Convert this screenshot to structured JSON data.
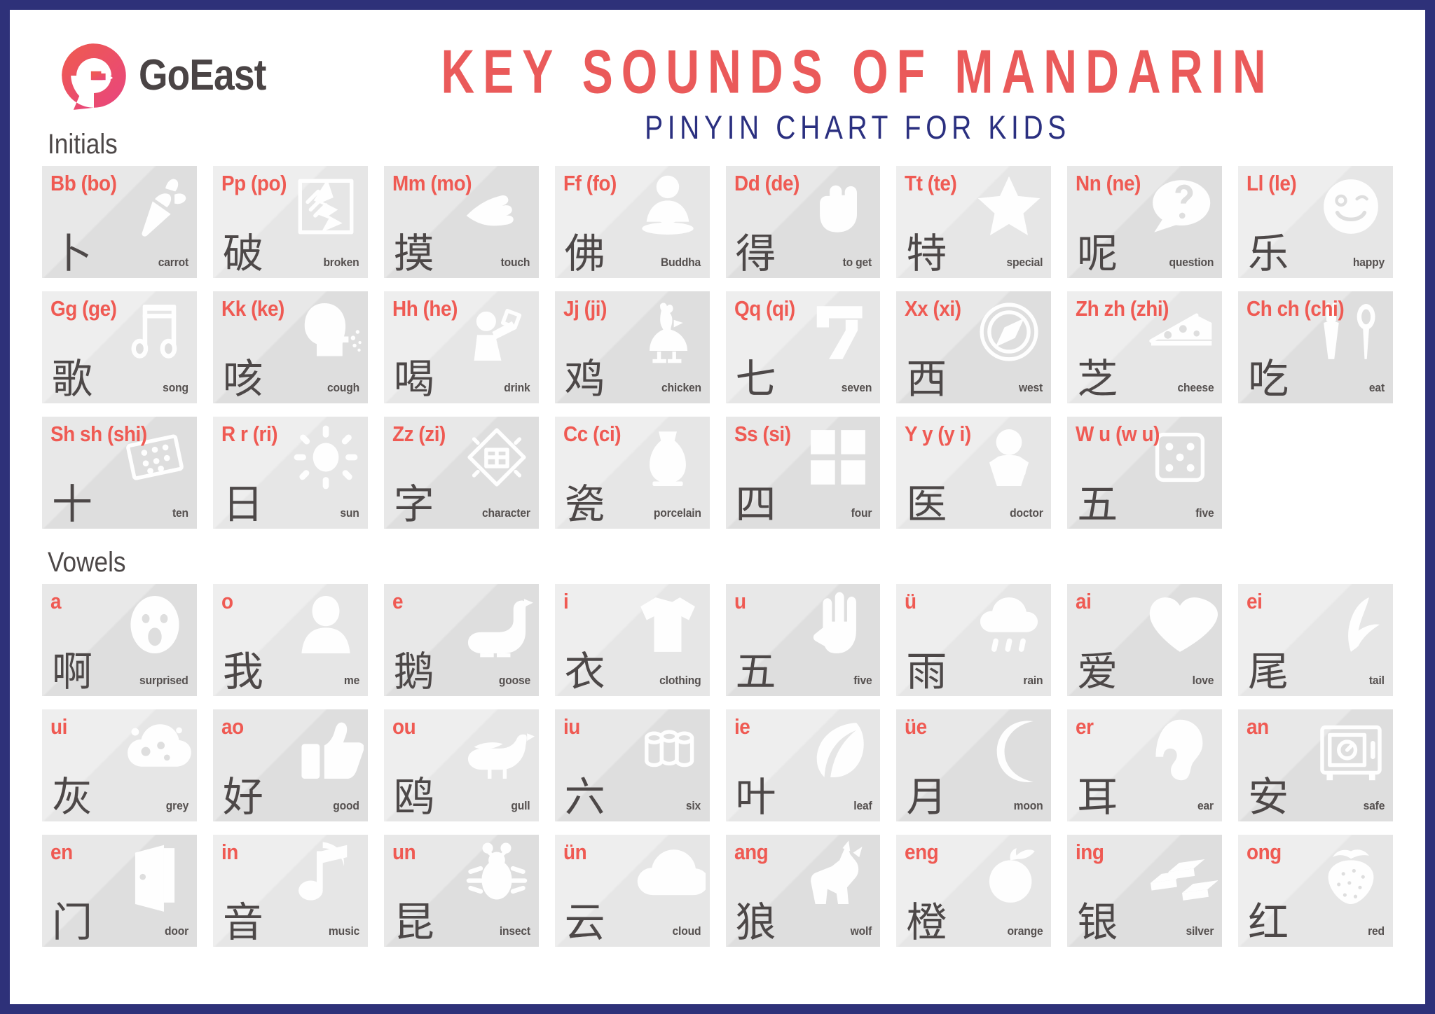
{
  "brand": {
    "name": "GoEast",
    "logo_icon": "goeast-g-logo-icon"
  },
  "header": {
    "title": "KEY SOUNDS OF MANDARIN",
    "subtitle": "PINYIN CHART FOR KIDS",
    "title_color": "#ea5a5a",
    "subtitle_color": "#2b3080",
    "frame_color": "#2e3179"
  },
  "sections": [
    {
      "heading": "Initials",
      "cards": [
        {
          "pinyin": "Bb (bo)",
          "hanzi": "卜",
          "meaning": "carrot",
          "icon": "carrot-icon"
        },
        {
          "pinyin": "Pp (po)",
          "hanzi": "破",
          "meaning": "broken",
          "icon": "broken-glass-icon"
        },
        {
          "pinyin": "Mm (mo)",
          "hanzi": "摸",
          "meaning": "touch",
          "icon": "pointing-hand-icon"
        },
        {
          "pinyin": "Ff (fo)",
          "hanzi": "佛",
          "meaning": "Buddha",
          "icon": "buddha-icon"
        },
        {
          "pinyin": "Dd (de)",
          "hanzi": "得",
          "meaning": "to get",
          "icon": "fist-icon"
        },
        {
          "pinyin": "Tt (te)",
          "hanzi": "特",
          "meaning": "special",
          "icon": "star-icon"
        },
        {
          "pinyin": "Nn (ne)",
          "hanzi": "呢",
          "meaning": "question",
          "icon": "question-bubble-icon"
        },
        {
          "pinyin": "Ll (le)",
          "hanzi": "乐",
          "meaning": "happy",
          "icon": "happy-face-icon"
        },
        {
          "pinyin": "Gg (ge)",
          "hanzi": "歌",
          "meaning": "song",
          "icon": "music-notes-icon"
        },
        {
          "pinyin": "Kk (ke)",
          "hanzi": "咳",
          "meaning": "cough",
          "icon": "coughing-head-icon"
        },
        {
          "pinyin": "Hh (he)",
          "hanzi": "喝",
          "meaning": "drink",
          "icon": "person-drinking-icon"
        },
        {
          "pinyin": "Jj (ji)",
          "hanzi": "鸡",
          "meaning": "chicken",
          "icon": "chicken-icon"
        },
        {
          "pinyin": "Qq (qi)",
          "hanzi": "七",
          "meaning": "seven",
          "icon": "digital-seven-icon"
        },
        {
          "pinyin": "Xx (xi)",
          "hanzi": "西",
          "meaning": "west",
          "icon": "compass-west-icon"
        },
        {
          "pinyin": "Zh zh (zhi)",
          "hanzi": "芝",
          "meaning": "cheese",
          "icon": "cheese-wedge-icon"
        },
        {
          "pinyin": "Ch ch (chi)",
          "hanzi": "吃",
          "meaning": "eat",
          "icon": "fork-spoon-icon"
        },
        {
          "pinyin": "Sh sh (shi)",
          "hanzi": "十",
          "meaning": "ten",
          "icon": "domino-ten-icon"
        },
        {
          "pinyin": "R r (ri)",
          "hanzi": "日",
          "meaning": "sun",
          "icon": "sun-icon"
        },
        {
          "pinyin": "Zz (zi)",
          "hanzi": "字",
          "meaning": "character",
          "icon": "fu-character-diamond-icon"
        },
        {
          "pinyin": "Cc (ci)",
          "hanzi": "瓷",
          "meaning": "porcelain",
          "icon": "porcelain-vase-icon"
        },
        {
          "pinyin": "Ss (si)",
          "hanzi": "四",
          "meaning": "four",
          "icon": "four-squares-icon"
        },
        {
          "pinyin": "Y y (y i)",
          "hanzi": "医",
          "meaning": "doctor",
          "icon": "doctor-icon"
        },
        {
          "pinyin": "W u (w u)",
          "hanzi": "五",
          "meaning": "five",
          "icon": "dice-five-icon"
        }
      ]
    },
    {
      "heading": "Vowels",
      "cards": [
        {
          "pinyin": "a",
          "hanzi": "啊",
          "meaning": "surprised",
          "icon": "surprised-face-icon"
        },
        {
          "pinyin": "o",
          "hanzi": "我",
          "meaning": "me",
          "icon": "person-self-icon"
        },
        {
          "pinyin": "e",
          "hanzi": "鹅",
          "meaning": "goose",
          "icon": "goose-icon"
        },
        {
          "pinyin": "i",
          "hanzi": "衣",
          "meaning": "clothing",
          "icon": "tshirt-icon"
        },
        {
          "pinyin": "u",
          "hanzi": "五",
          "meaning": "five",
          "icon": "open-hand-icon"
        },
        {
          "pinyin": "ü",
          "hanzi": "雨",
          "meaning": "rain",
          "icon": "rain-cloud-icon"
        },
        {
          "pinyin": "ai",
          "hanzi": "爱",
          "meaning": "love",
          "icon": "heart-icon"
        },
        {
          "pinyin": "ei",
          "hanzi": "尾",
          "meaning": "tail",
          "icon": "whale-tail-icon"
        },
        {
          "pinyin": "ui",
          "hanzi": "灰",
          "meaning": "grey",
          "icon": "ash-cloud-icon"
        },
        {
          "pinyin": "ao",
          "hanzi": "好",
          "meaning": "good",
          "icon": "thumbs-up-icon"
        },
        {
          "pinyin": "ou",
          "hanzi": "鸥",
          "meaning": "gull",
          "icon": "seagull-icon"
        },
        {
          "pinyin": "iu",
          "hanzi": "六",
          "meaning": "six",
          "icon": "six-cylinders-icon"
        },
        {
          "pinyin": "ie",
          "hanzi": "叶",
          "meaning": "leaf",
          "icon": "leaf-icon"
        },
        {
          "pinyin": "üe",
          "hanzi": "月",
          "meaning": "moon",
          "icon": "crescent-moon-icon"
        },
        {
          "pinyin": "er",
          "hanzi": "耳",
          "meaning": "ear",
          "icon": "ear-icon"
        },
        {
          "pinyin": "an",
          "hanzi": "安",
          "meaning": "safe",
          "icon": "safe-box-icon"
        },
        {
          "pinyin": "en",
          "hanzi": "门",
          "meaning": "door",
          "icon": "door-icon"
        },
        {
          "pinyin": "in",
          "hanzi": "音",
          "meaning": "music",
          "icon": "music-note-icon"
        },
        {
          "pinyin": "un",
          "hanzi": "昆",
          "meaning": "insect",
          "icon": "insect-icon"
        },
        {
          "pinyin": "ün",
          "hanzi": "云",
          "meaning": "cloud",
          "icon": "cloud-icon"
        },
        {
          "pinyin": "ang",
          "hanzi": "狼",
          "meaning": "wolf",
          "icon": "howling-wolf-icon"
        },
        {
          "pinyin": "eng",
          "hanzi": "橙",
          "meaning": "orange",
          "icon": "orange-fruit-icon"
        },
        {
          "pinyin": "ing",
          "hanzi": "银",
          "meaning": "silver",
          "icon": "silver-bars-icon"
        },
        {
          "pinyin": "ong",
          "hanzi": "红",
          "meaning": "red",
          "icon": "strawberry-icon"
        }
      ]
    }
  ]
}
